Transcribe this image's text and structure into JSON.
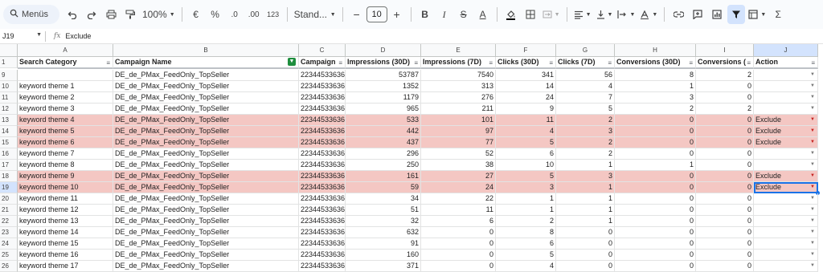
{
  "toolbar": {
    "menus_label": "Menüs",
    "zoom": "100%",
    "currency": "€",
    "percent": "%",
    "dec_dec": ".0",
    "dec_inc": ".00",
    "num_format": "123",
    "font": "Stand...",
    "font_size": "10",
    "bold": "B",
    "italic": "I",
    "strike": "S",
    "underline_a": "A",
    "sigma": "Σ"
  },
  "formula_bar": {
    "cell_ref": "J19",
    "fx": "fx",
    "content": "Exclude"
  },
  "columns": [
    {
      "letter": "A",
      "header": "Search Category",
      "filter_active": false
    },
    {
      "letter": "B",
      "header": "Campaign Name",
      "filter_active": true
    },
    {
      "letter": "C",
      "header": "Campaign",
      "filter_active": false
    },
    {
      "letter": "D",
      "header": "Impressions (30D)",
      "filter_active": false
    },
    {
      "letter": "E",
      "header": "Impressions (7D)",
      "filter_active": false
    },
    {
      "letter": "F",
      "header": "Clicks (30D)",
      "filter_active": false
    },
    {
      "letter": "G",
      "header": "Clicks (7D)",
      "filter_active": false
    },
    {
      "letter": "H",
      "header": "Conversions (30D)",
      "filter_active": false
    },
    {
      "letter": "I",
      "header": "Conversions (",
      "filter_active": false
    },
    {
      "letter": "J",
      "header": "Action",
      "filter_active": false
    }
  ],
  "rows": [
    {
      "n": "9",
      "cat": "",
      "name": "DE_de_PMax_FeedOnly_TopSeller",
      "id": "22344533636",
      "i30": "53787",
      "i7": "7540",
      "c30": "341",
      "c7": "56",
      "v30": "8",
      "v7": "2",
      "action": "",
      "hl": false
    },
    {
      "n": "10",
      "cat": "keyword theme 1",
      "name": "DE_de_PMax_FeedOnly_TopSeller",
      "id": "22344533636",
      "i30": "1352",
      "i7": "313",
      "c30": "14",
      "c7": "4",
      "v30": "1",
      "v7": "0",
      "action": "",
      "hl": false
    },
    {
      "n": "11",
      "cat": "keyword theme 2",
      "name": "DE_de_PMax_FeedOnly_TopSeller",
      "id": "22344533636",
      "i30": "1179",
      "i7": "276",
      "c30": "24",
      "c7": "7",
      "v30": "3",
      "v7": "0",
      "action": "",
      "hl": false
    },
    {
      "n": "12",
      "cat": "keyword theme 3",
      "name": "DE_de_PMax_FeedOnly_TopSeller",
      "id": "22344533636",
      "i30": "965",
      "i7": "211",
      "c30": "9",
      "c7": "5",
      "v30": "2",
      "v7": "2",
      "action": "",
      "hl": false
    },
    {
      "n": "13",
      "cat": "keyword theme 4",
      "name": "DE_de_PMax_FeedOnly_TopSeller",
      "id": "22344533636",
      "i30": "533",
      "i7": "101",
      "c30": "11",
      "c7": "2",
      "v30": "0",
      "v7": "0",
      "action": "Exclude",
      "hl": true
    },
    {
      "n": "14",
      "cat": "keyword theme 5",
      "name": "DE_de_PMax_FeedOnly_TopSeller",
      "id": "22344533636",
      "i30": "442",
      "i7": "97",
      "c30": "4",
      "c7": "3",
      "v30": "0",
      "v7": "0",
      "action": "Exclude",
      "hl": true
    },
    {
      "n": "15",
      "cat": "keyword theme 6",
      "name": "DE_de_PMax_FeedOnly_TopSeller",
      "id": "22344533636",
      "i30": "437",
      "i7": "77",
      "c30": "5",
      "c7": "2",
      "v30": "0",
      "v7": "0",
      "action": "Exclude",
      "hl": true
    },
    {
      "n": "16",
      "cat": "keyword theme 7",
      "name": "DE_de_PMax_FeedOnly_TopSeller",
      "id": "22344533636",
      "i30": "296",
      "i7": "52",
      "c30": "6",
      "c7": "2",
      "v30": "0",
      "v7": "0",
      "action": "",
      "hl": false
    },
    {
      "n": "17",
      "cat": "keyword theme 8",
      "name": "DE_de_PMax_FeedOnly_TopSeller",
      "id": "22344533636",
      "i30": "250",
      "i7": "38",
      "c30": "10",
      "c7": "1",
      "v30": "1",
      "v7": "0",
      "action": "",
      "hl": false
    },
    {
      "n": "18",
      "cat": "keyword theme 9",
      "name": "DE_de_PMax_FeedOnly_TopSeller",
      "id": "22344533636",
      "i30": "161",
      "i7": "27",
      "c30": "5",
      "c7": "3",
      "v30": "0",
      "v7": "0",
      "action": "Exclude",
      "hl": true
    },
    {
      "n": "19",
      "cat": "keyword theme 10",
      "name": "DE_de_PMax_FeedOnly_TopSeller",
      "id": "22344533636",
      "i30": "59",
      "i7": "24",
      "c30": "3",
      "c7": "1",
      "v30": "0",
      "v7": "0",
      "action": "Exclude",
      "hl": true
    },
    {
      "n": "20",
      "cat": "keyword theme 11",
      "name": "DE_de_PMax_FeedOnly_TopSeller",
      "id": "22344533636",
      "i30": "34",
      "i7": "22",
      "c30": "1",
      "c7": "1",
      "v30": "0",
      "v7": "0",
      "action": "",
      "hl": false
    },
    {
      "n": "21",
      "cat": "keyword theme 12",
      "name": "DE_de_PMax_FeedOnly_TopSeller",
      "id": "22344533636",
      "i30": "51",
      "i7": "11",
      "c30": "1",
      "c7": "1",
      "v30": "0",
      "v7": "0",
      "action": "",
      "hl": false
    },
    {
      "n": "22",
      "cat": "keyword theme 13",
      "name": "DE_de_PMax_FeedOnly_TopSeller",
      "id": "22344533636",
      "i30": "32",
      "i7": "6",
      "c30": "2",
      "c7": "1",
      "v30": "0",
      "v7": "0",
      "action": "",
      "hl": false
    },
    {
      "n": "23",
      "cat": "keyword theme 14",
      "name": "DE_de_PMax_FeedOnly_TopSeller",
      "id": "22344533636",
      "i30": "632",
      "i7": "0",
      "c30": "8",
      "c7": "0",
      "v30": "0",
      "v7": "0",
      "action": "",
      "hl": false
    },
    {
      "n": "24",
      "cat": "keyword theme 15",
      "name": "DE_de_PMax_FeedOnly_TopSeller",
      "id": "22344533636",
      "i30": "91",
      "i7": "0",
      "c30": "6",
      "c7": "0",
      "v30": "0",
      "v7": "0",
      "action": "",
      "hl": false
    },
    {
      "n": "25",
      "cat": "keyword theme 16",
      "name": "DE_de_PMax_FeedOnly_TopSeller",
      "id": "22344533636",
      "i30": "160",
      "i7": "0",
      "c30": "5",
      "c7": "0",
      "v30": "0",
      "v7": "0",
      "action": "",
      "hl": false
    },
    {
      "n": "26",
      "cat": "keyword theme 17",
      "name": "DE_de_PMax_FeedOnly_TopSeller",
      "id": "22344533636",
      "i30": "371",
      "i7": "0",
      "c30": "4",
      "c7": "0",
      "v30": "0",
      "v7": "0",
      "action": "",
      "hl": false
    }
  ],
  "selected_row": "19",
  "selected_col": "J",
  "colors": {
    "highlight": "#f4c7c3",
    "selection": "#1a73e8",
    "filter_on": "#1e8e3e"
  }
}
